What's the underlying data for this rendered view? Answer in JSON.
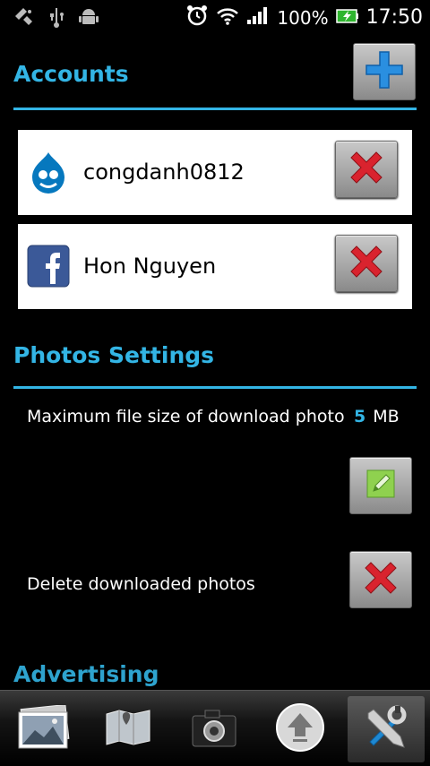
{
  "status_bar": {
    "battery": "100%",
    "time": "17:50"
  },
  "accounts": {
    "title": "Accounts",
    "items": [
      {
        "name": "congdanh0812",
        "service_icon": "drupal-icon"
      },
      {
        "name": "Hon Nguyen",
        "service_icon": "facebook-icon"
      }
    ]
  },
  "photos_settings": {
    "title": "Photos Settings",
    "max_file_label": "Maximum file size of download photo",
    "max_file_value": "5",
    "max_file_unit": "MB",
    "delete_label": "Delete downloaded photos"
  },
  "advertising": {
    "title": "Advertising"
  },
  "tabs": [
    {
      "icon": "gallery-icon"
    },
    {
      "icon": "map-icon"
    },
    {
      "icon": "camera-icon"
    },
    {
      "icon": "upload-icon"
    },
    {
      "icon": "settings-tools-icon",
      "active": true
    }
  ],
  "colors": {
    "accent": "#33b5e5",
    "delete_red": "#d9232e",
    "add_blue": "#2a8fe0"
  }
}
